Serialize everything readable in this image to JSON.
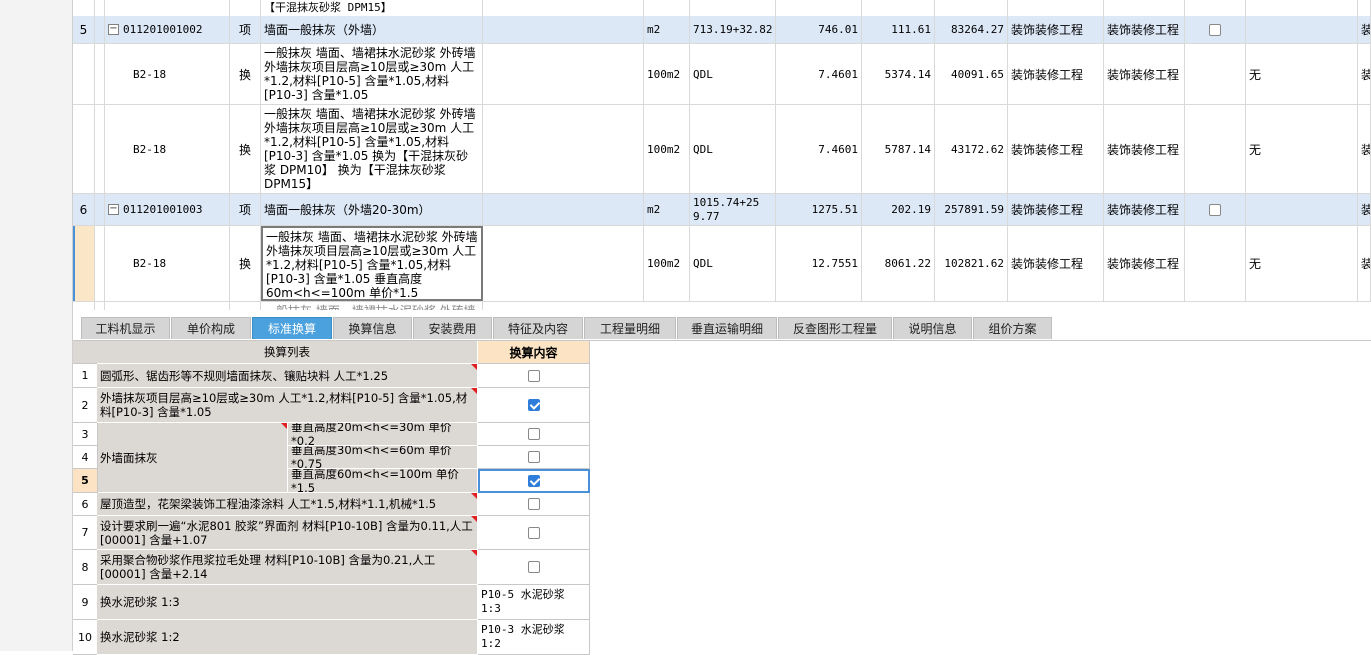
{
  "top_grid": {
    "partial_row": {
      "name_tail": "【干混抹灰砂浆 DPM15】"
    },
    "rows": [
      {
        "seq": "5",
        "code": "011201001002",
        "type": "项",
        "name": "墙面一般抹灰（外墙）",
        "unit": "m2",
        "qty_expr": "713.19+32.82",
        "qty": "746.01",
        "price": "111.61",
        "total": "83264.27",
        "major": "装饰装修工程",
        "sub": "装饰装修工程",
        "extra": "",
        "last": "装"
      },
      {
        "seq": "",
        "code": "B2-18",
        "type": "换",
        "name": "一般抹灰 墙面、墙裙抹水泥砂浆 外砖墙 外墙抹灰项目层高≥10层或≥30m 人工*1.2,材料[P10-5] 含量*1.05,材料[P10-3] 含量*1.05",
        "unit": "100m2",
        "qty_expr": "QDL",
        "qty": "7.4601",
        "price": "5374.14",
        "total": "40091.65",
        "major": "装饰装修工程",
        "sub": "装饰装修工程",
        "extra": "无",
        "last": "装"
      },
      {
        "seq": "",
        "code": "B2-18",
        "type": "换",
        "name": "一般抹灰 墙面、墙裙抹水泥砂浆 外砖墙 外墙抹灰项目层高≥10层或≥30m 人工*1.2,材料[P10-5] 含量*1.05,材料[P10-3] 含量*1.05  换为【干混抹灰砂浆 DPM10】 换为【干混抹灰砂浆 DPM15】",
        "unit": "100m2",
        "qty_expr": "QDL",
        "qty": "7.4601",
        "price": "5787.14",
        "total": "43172.62",
        "major": "装饰装修工程",
        "sub": "装饰装修工程",
        "extra": "无",
        "last": "装"
      },
      {
        "seq": "6",
        "code": "011201001003",
        "type": "项",
        "name": "墙面一般抹灰（外墙20-30m）",
        "unit": "m2",
        "qty_expr": "1015.74+259.77",
        "qty": "1275.51",
        "price": "202.19",
        "total": "257891.59",
        "major": "装饰装修工程",
        "sub": "装饰装修工程",
        "extra": "",
        "last": "装"
      },
      {
        "seq": "",
        "code": "B2-18",
        "type": "换",
        "name": "一般抹灰 墙面、墙裙抹水泥砂浆 外砖墙 外墙抹灰项目层高≥10层或≥30m 人工*1.2,材料[P10-5] 含量*1.05,材料[P10-3] 含量*1.05  垂直高度60m<h<=100m 单价*1.5",
        "unit": "100m2",
        "qty_expr": "QDL",
        "qty": "12.7551",
        "price": "8061.22",
        "total": "102821.62",
        "major": "装饰装修工程",
        "sub": "装饰装修工程",
        "extra": "无",
        "last": "装"
      }
    ],
    "trailing_fragment": "一般抹灰 墙面、墙裙抹水泥砂浆 外砖墙"
  },
  "tabs": [
    "工料机显示",
    "单价构成",
    "标准换算",
    "换算信息",
    "安装费用",
    "特征及内容",
    "工程量明细",
    "垂直运输明细",
    "反查图形工程量",
    "说明信息",
    "组价方案"
  ],
  "active_tab": "标准换算",
  "conversion": {
    "header_list": "换算列表",
    "header_content": "换算内容",
    "rows": [
      {
        "n": "1",
        "text": "圆弧形、锯齿形等不规则墙面抹灰、镶贴块料 人工*1.25",
        "checked": false
      },
      {
        "n": "2",
        "text": "外墙抹灰项目层高≥10层或≥30m 人工*1.2,材料[P10-5] 含量*1.05,材料[P10-3] 含量*1.05",
        "checked": true
      },
      {
        "n": "3",
        "group": "外墙面抹灰",
        "text": "垂直高度20m<h<=30m 单价*0.2",
        "checked": false
      },
      {
        "n": "4",
        "text": "垂直高度30m<h<=60m 单价*0.75",
        "checked": false
      },
      {
        "n": "5",
        "text": "垂直高度60m<h<=100m 单价*1.5",
        "checked": true
      },
      {
        "n": "6",
        "text": "屋顶造型，花架梁装饰工程油漆涂料 人工*1.5,材料*1.1,机械*1.5",
        "checked": false
      },
      {
        "n": "7",
        "text": "设计要求刷一遍“水泥801 胶浆”界面剂 材料[P10-10B] 含量为0.11,人工[00001] 含量+1.07",
        "checked": false
      },
      {
        "n": "8",
        "text": "采用聚合物砂浆作甩浆拉毛处理 材料[P10-10B] 含量为0.21,人工[00001] 含量+2.14",
        "checked": false
      },
      {
        "n": "9",
        "text": "换水泥砂浆 1:3",
        "value": "P10-5  水泥砂浆 1:3"
      },
      {
        "n": "10",
        "text": "换水泥砂浆 1:2",
        "value": "P10-3  水泥砂浆 1:2"
      }
    ]
  },
  "colors": {
    "selected_row": "#dde8f7",
    "active_tab": "#4aa1dd",
    "header_orange": "#fbe3c3",
    "list_cell": "#dcd8d4",
    "check_blue": "#2f7ddb"
  }
}
